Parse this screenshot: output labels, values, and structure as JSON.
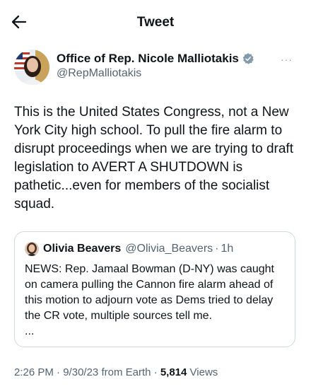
{
  "topbar": {
    "title": "Tweet",
    "back_icon": "back-arrow-icon"
  },
  "author": {
    "name": "Office of Rep. Nicole Malliotakis",
    "handle": "@RepMalliotakis",
    "verified_icon": "verified-badge-icon",
    "more_label": "···"
  },
  "tweet": {
    "text": "This is the United States Congress, not a New York City high school. To pull the fire alarm to disrupt proceedings when we are trying to draft legislation to AVERT A SHUTDOWN is pathetic...even for members of the socialist squad."
  },
  "quote": {
    "name": "Olivia Beavers",
    "handle": "@Olivia_Beavers",
    "separator": "·",
    "time": "1h",
    "text": "NEWS: Rep. Jamaal Bowman (D-NY) was caught on camera pulling the Cannon fire alarm ahead of this motion to adjourn vote as Dems tried to delay the CR vote, multiple sources tell me.",
    "ellipsis": "..."
  },
  "meta": {
    "time": "2:26 PM",
    "date": "9/30/23",
    "source": "from Earth",
    "views_count": "5,814",
    "views_label": "Views",
    "separator": "·"
  },
  "colors": {
    "text": "#0f1419",
    "muted": "#536471",
    "verified": "#829aab",
    "border": "#cfd9de"
  }
}
